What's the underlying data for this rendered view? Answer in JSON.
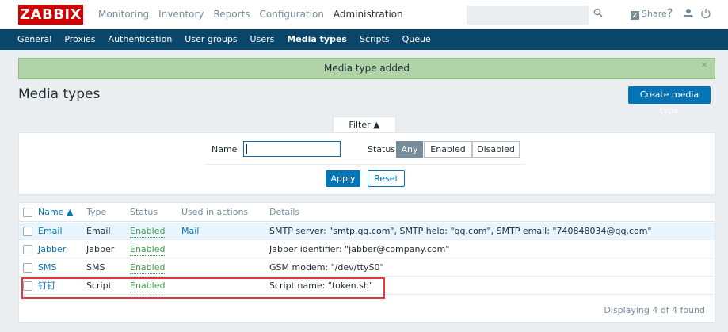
{
  "logo": "ZABBIX",
  "top_menu": [
    "Monitoring",
    "Inventory",
    "Reports",
    "Configuration",
    "Administration"
  ],
  "top_menu_active": "Administration",
  "search": {
    "placeholder": ""
  },
  "share_label": "Share",
  "share_mark": "Z",
  "help_label": "?",
  "sub_menu": [
    "General",
    "Proxies",
    "Authentication",
    "User groups",
    "Users",
    "Media types",
    "Scripts",
    "Queue"
  ],
  "sub_menu_active": "Media types",
  "message": {
    "text": "Media type added",
    "close": "×"
  },
  "page": {
    "title": "Media types",
    "create_button": "Create media type"
  },
  "filter": {
    "tab_label": "Filter ▲",
    "name_label": "Name",
    "name_value": "",
    "status_label": "Status",
    "status_options": [
      "Any",
      "Enabled",
      "Disabled"
    ],
    "status_selected": "Any",
    "apply": "Apply",
    "reset": "Reset"
  },
  "table": {
    "headers": [
      "Name ▲",
      "Type",
      "Status",
      "Used in actions",
      "Details"
    ],
    "rows": [
      {
        "name": "Email",
        "type": "Email",
        "status": "Enabled",
        "used": "Mail",
        "details": "SMTP server: \"smtp.qq.com\", SMTP helo: \"qq.com\", SMTP email: \"740848034@qq.com\""
      },
      {
        "name": "Jabber",
        "type": "Jabber",
        "status": "Enabled",
        "used": "",
        "details": "Jabber identifier: \"jabber@company.com\""
      },
      {
        "name": "SMS",
        "type": "SMS",
        "status": "Enabled",
        "used": "",
        "details": "GSM modem: \"/dev/ttyS0\""
      },
      {
        "name": "钉钉",
        "type": "Script",
        "status": "Enabled",
        "used": "",
        "details": "Script name: \"token.sh\""
      }
    ],
    "footer": "Displaying 4 of 4 found"
  },
  "colors": {
    "brand": "#d40000",
    "nav": "#0a466a",
    "accent": "#0275b8",
    "success_bg": "#b0d3a8",
    "enabled": "#429e47",
    "highlight": "#e8363c"
  }
}
